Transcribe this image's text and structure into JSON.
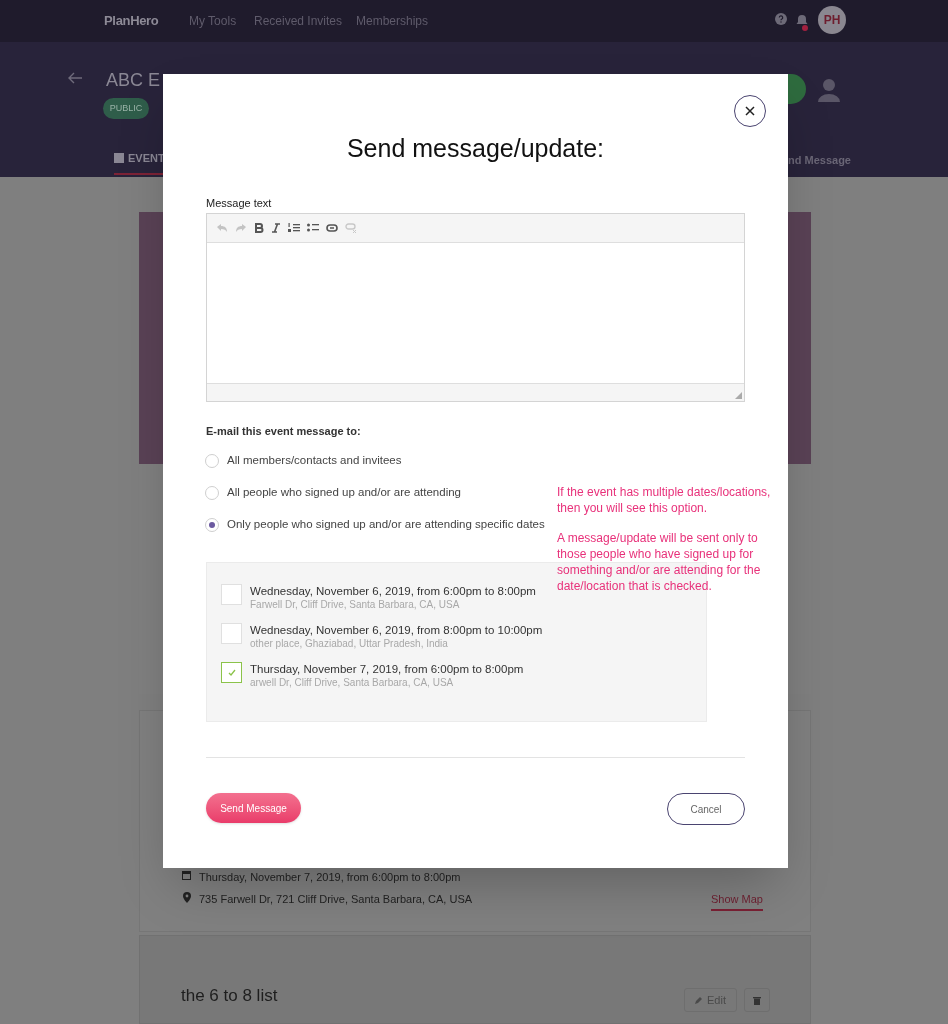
{
  "navbar": {
    "brand": "PlanHero",
    "links": [
      "My Tools",
      "Received Invites",
      "Memberships"
    ],
    "avatar": "PH",
    "notification_unread": true
  },
  "event_header": {
    "title": "ABC E",
    "badge": "PUBLIC",
    "tab": "EVENT",
    "right_tab": "nd Message"
  },
  "modal": {
    "title": "Send message/update:",
    "message_label": "Message text",
    "recipients_label": "E-mail this event message to:",
    "options": [
      {
        "label": "All members/contacts and invitees",
        "selected": false
      },
      {
        "label": "All people who signed up and/or are attending",
        "selected": false
      },
      {
        "label": "Only people who signed up and/or are attending specific dates",
        "selected": true
      }
    ],
    "dates": [
      {
        "when": "Wednesday, November 6, 2019, from 6:00pm to 8:00pm",
        "where": "Farwell Dr, Cliff Drive, Santa Barbara, CA, USA",
        "checked": false
      },
      {
        "when": "Wednesday, November 6, 2019, from 8:00pm to 10:00pm",
        "where": "other place, Ghaziabad, Uttar Pradesh, India",
        "checked": false
      },
      {
        "when": "Thursday, November 7, 2019, from 6:00pm to 8:00pm",
        "where": "arwell Dr, Cliff Drive, Santa Barbara, CA, USA",
        "checked": true
      }
    ],
    "note": [
      "If the event has multiple dates/locations, then you will see this option.",
      "A message/update will be sent only to those people who have signed up for something and/or are attending for the date/location that is checked."
    ],
    "send_button": "Send Message",
    "cancel_button": "Cancel"
  },
  "background": {
    "date": "Thursday, November 7, 2019, from 6:00pm to 8:00pm",
    "address": "735 Farwell Dr, 721 Cliff Drive, Santa Barbara, CA, USA",
    "map_link": "Show Map",
    "list_title": "the 6 to 8 list",
    "edit_button": "Edit"
  }
}
